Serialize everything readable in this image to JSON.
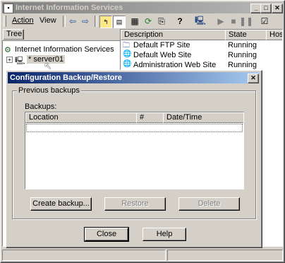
{
  "main_window": {
    "title": "Internet Information Services",
    "menu": {
      "action": "Action",
      "view": "View"
    },
    "tree_tab": "Tree",
    "tree": {
      "root": "Internet Information Services",
      "server": "* server01"
    },
    "list_columns": [
      "Description",
      "State",
      "Host"
    ],
    "list_rows": [
      {
        "description": "Default FTP Site",
        "state": "Running"
      },
      {
        "description": "Default Web Site",
        "state": "Running"
      },
      {
        "description": "Administration Web Site",
        "state": "Running"
      }
    ]
  },
  "dialog": {
    "title": "Configuration Backup/Restore",
    "group_label": "Previous backups",
    "backups_label": "Backups:",
    "columns": [
      "Location",
      "#",
      "Date/Time"
    ],
    "buttons": {
      "create": "Create backup...",
      "restore": "Restore",
      "delete": "Delete",
      "close": "Close",
      "help": "Help"
    }
  },
  "colors": {
    "dialog_title": "#0a246a",
    "inactive_title": "#808080",
    "face": "#d4d0c8"
  }
}
